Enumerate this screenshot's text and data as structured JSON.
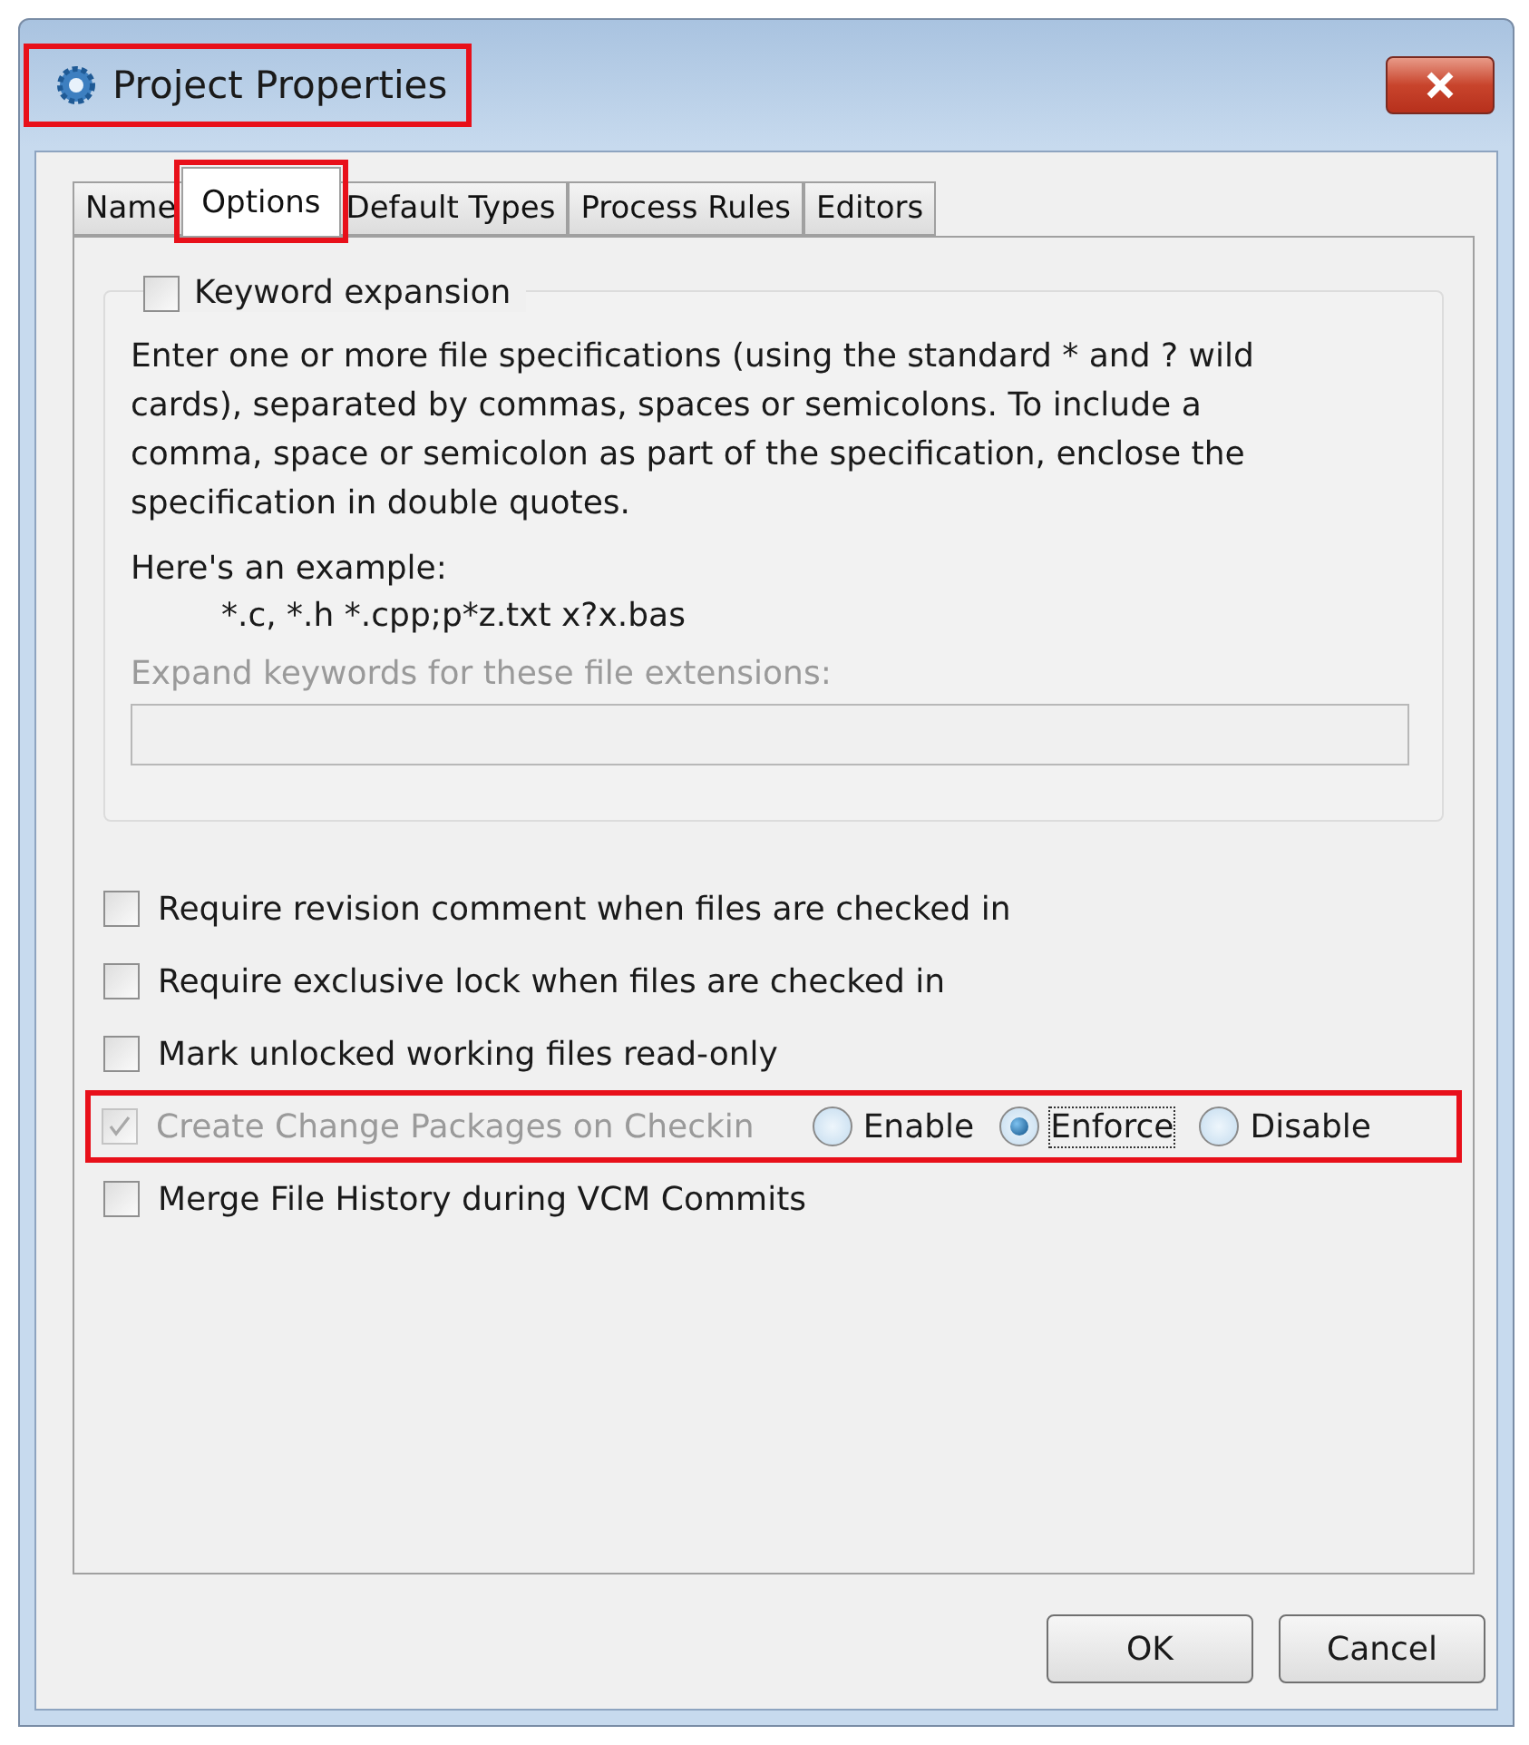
{
  "window": {
    "title": "Project Properties",
    "highlighted": true
  },
  "tabs": [
    {
      "label": "Name",
      "selected": false,
      "highlighted": false
    },
    {
      "label": "Options",
      "selected": true,
      "highlighted": true
    },
    {
      "label": "Default Types",
      "selected": false,
      "highlighted": false
    },
    {
      "label": "Process Rules",
      "selected": false,
      "highlighted": false
    },
    {
      "label": "Editors",
      "selected": false,
      "highlighted": false
    }
  ],
  "keyword_group": {
    "label": "Keyword expansion",
    "checked": false,
    "description": "Enter one or more file specifications (using the standard * and ? wild cards), separated by commas, spaces or semicolons.  To include a comma, space or semicolon as part of the specification, enclose the specification in double quotes.",
    "example_heading": "Here's an example:",
    "example": "*.c, *.h *.cpp;p*z.txt x?x.bas",
    "field_label": "Expand keywords for these file extensions:",
    "field_disabled": true
  },
  "options": [
    {
      "kind": "checkbox",
      "label": "Require revision comment when files are checked in",
      "checked": false,
      "disabled": false
    },
    {
      "kind": "checkbox",
      "label": "Require exclusive lock when files are checked in",
      "checked": false,
      "disabled": false
    },
    {
      "kind": "checkbox",
      "label": "Mark unlocked working files read-only",
      "checked": false,
      "disabled": false
    },
    {
      "kind": "checkbox_radios",
      "label": "Create Change Packages on Checkin",
      "checked": true,
      "disabled": true,
      "highlighted": true,
      "choices": [
        {
          "label": "Enable",
          "selected": false
        },
        {
          "label": "Enforce",
          "selected": true
        },
        {
          "label": "Disable",
          "selected": false
        }
      ]
    },
    {
      "kind": "checkbox",
      "label": "Merge File History during VCM Commits",
      "checked": false,
      "disabled": false
    }
  ],
  "buttons": [
    "OK",
    "Cancel"
  ]
}
